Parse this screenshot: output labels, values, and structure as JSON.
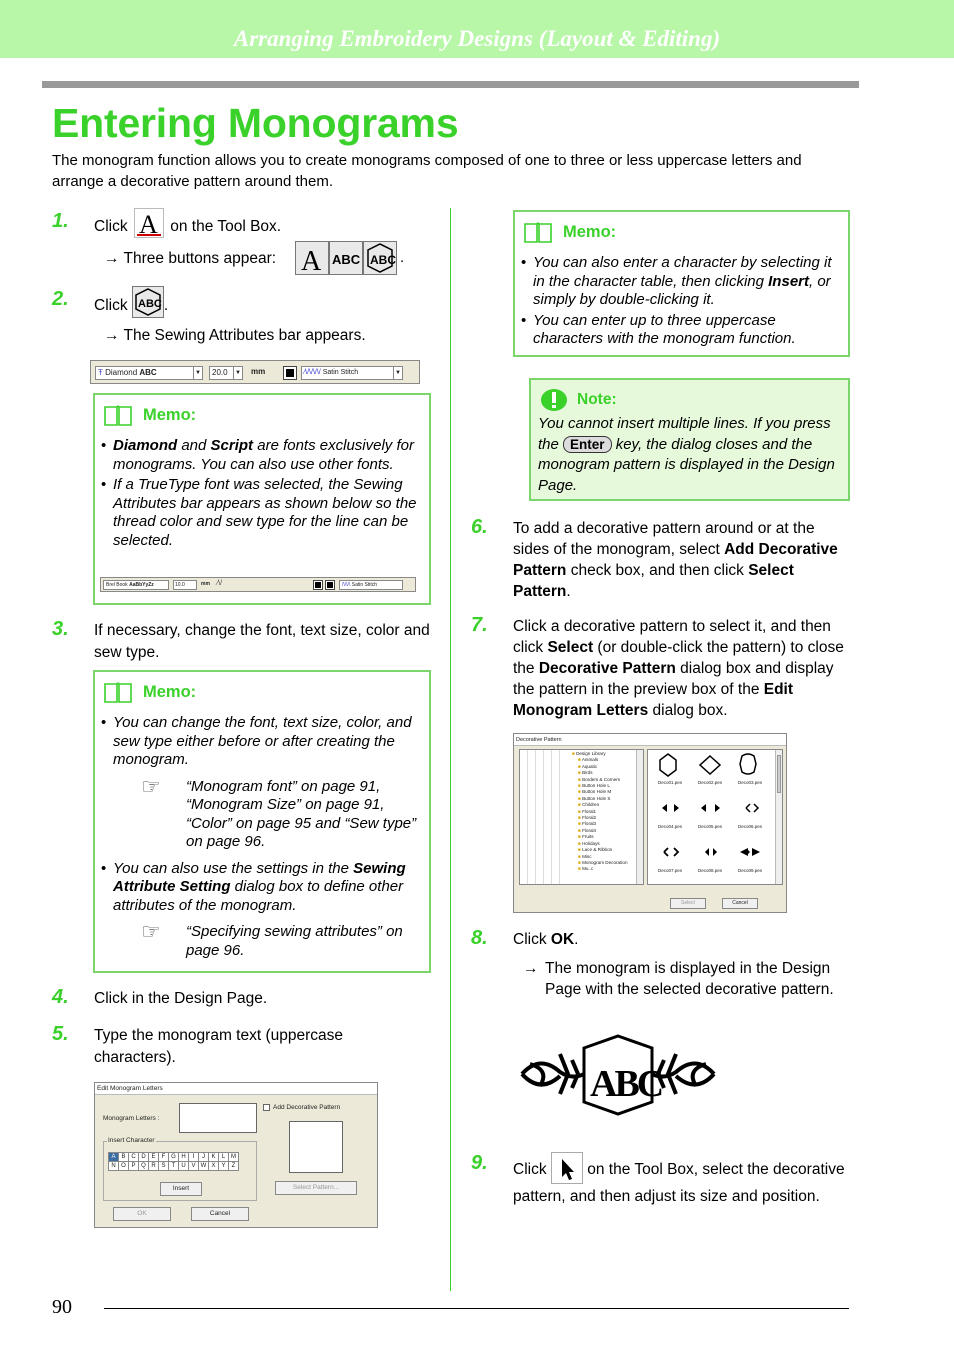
{
  "header": {
    "banner": "Arranging Embroidery Designs (Layout & Editing)"
  },
  "title": "Entering Monograms",
  "intro": "The monogram function allows you to create monograms composed of one to three or less uppercase letters and arrange a decorative pattern around them.",
  "steps": {
    "s1": {
      "num": "1.",
      "pre": "Click",
      "post": "on the Tool Box.",
      "result": "Three buttons appear:",
      "icon": "text-tool-icon",
      "buttons": [
        "text-button",
        "small-text-button",
        "monogram-button"
      ]
    },
    "s2": {
      "num": "2.",
      "pre": "Click",
      "post": ".",
      "result": "The Sewing Attributes bar appears.",
      "icon": "monogram-button-icon"
    },
    "s3": {
      "num": "3.",
      "text": "If necessary, change the font, text size, color and sew type."
    },
    "s4": {
      "num": "4.",
      "text": "Click in the Design Page."
    },
    "s5": {
      "num": "5.",
      "text": "Type the monogram text (uppercase characters)."
    },
    "s6": {
      "num": "6.",
      "t1": "To add a decorative pattern around or at the sides of the monogram, select ",
      "b1": "Add Decorative Pattern",
      "t2": " check box, and then click ",
      "b2": "Select Pattern",
      "t3": "."
    },
    "s7": {
      "num": "7.",
      "t1": "Click a decorative pattern to select it, and then click ",
      "b1": "Select",
      "t2": " (or double-click the pattern) to close the ",
      "b2": "Decorative Pattern",
      "t3": " dialog box and display the pattern in the preview box of the ",
      "b3": "Edit Monogram Letters",
      "t4": " dialog box."
    },
    "s8": {
      "num": "8.",
      "pre": "Click ",
      "bold": "OK",
      "post": ".",
      "result": "The monogram is displayed in the Design Page with the selected decorative pattern."
    },
    "s9": {
      "num": "9.",
      "pre": "Click",
      "post": "on the Tool Box, select the decorative pattern, and then adjust its size and position.",
      "icon": "select-arrow-icon"
    }
  },
  "arrow_glyph": "→",
  "attr_bar1": {
    "font": "Diamond",
    "font_sample": "ABC",
    "size": "20.0",
    "unit": "mm",
    "sew_type": "Satin Stitch"
  },
  "attr_bar2": {
    "font": "Brel Book",
    "font_sample": "AaBbYyZz",
    "size": "10.0",
    "unit": "mm",
    "sew_type": "Satin Stitch"
  },
  "memo1": {
    "label": "Memo:",
    "b1_bold1": "Diamond",
    "b1_t1": " and ",
    "b1_bold2": "Script",
    "b1_t2": " are fonts exclusively for monograms. You can also use other fonts.",
    "b2": "If a TrueType font was selected, the Sewing Attributes bar appears as shown below so the thread color and sew type for the line can be selected."
  },
  "memo2": {
    "label": "Memo:",
    "b1": "You can change the font, text size, color, and sew type either before or after creating the monogram.",
    "ref1": "“Monogram font” on page 91, “Monogram Size” on page 91, “Color” on page 95 and “Sew type” on page 96.",
    "b2_t1": "You can also use the settings in the ",
    "b2_bold": "Sewing Attribute Setting",
    "b2_t2": " dialog box to define other attributes of the monogram.",
    "ref2": "“Specifying sewing attributes” on page 96."
  },
  "memo3": {
    "label": "Memo:",
    "b1_t1": "You can also enter a character by selecting it in the character table, then clicking ",
    "b1_bold": "Insert",
    "b1_t2": ", or simply by double-clicking it.",
    "b2": "You can enter up to three uppercase characters with the monogram function."
  },
  "note": {
    "label": "Note:",
    "t1": "You cannot insert multiple lines. If you press the ",
    "key": "Enter",
    "t2": " key, the dialog closes and the monogram pattern is displayed in the Design Page."
  },
  "edit_dialog": {
    "title": "Edit Monogram Letters",
    "letters_label": "Monogram Letters :",
    "letters_value": "",
    "checkbox": "Add Decorative Pattern",
    "checked": false,
    "group": "Insert Character",
    "row1": [
      "A",
      "B",
      "C",
      "D",
      "E",
      "F",
      "G",
      "H",
      "I",
      "J",
      "K",
      "L",
      "M"
    ],
    "row2": [
      "N",
      "O",
      "P",
      "Q",
      "R",
      "S",
      "T",
      "U",
      "V",
      "W",
      "X",
      "Y",
      "Z"
    ],
    "insert": "Insert",
    "select_pattern": "Select Pattern...",
    "ok": "OK",
    "cancel": "Cancel"
  },
  "deco_dialog": {
    "title": "Decorative Pattern",
    "tree": [
      "Design Library",
      "Animals",
      "Aquatic",
      "Birds",
      "Borders & Corners",
      "Button Hole L",
      "Button Hole M",
      "Button Hole S",
      "Children",
      "Floral1",
      "Floral2",
      "Floral3",
      "Floral4",
      "Fruits",
      "Holidays",
      "Lace & Ribbon",
      "Misc",
      "Monogram Decoration",
      "Mu..c"
    ],
    "files": [
      "Deco01.pes",
      "Deco02.pes",
      "Deco03.pes",
      "Deco04.pes",
      "Deco05.pes",
      "Deco06.pes",
      "Deco07.pes",
      "Deco08.pes",
      "Deco09.pes"
    ],
    "select": "Select",
    "cancel": "Cancel"
  },
  "page_number": "90"
}
